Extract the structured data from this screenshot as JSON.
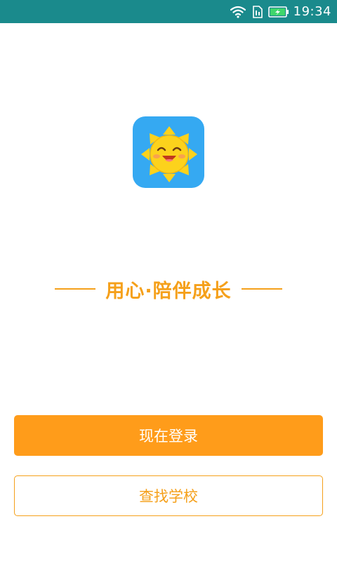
{
  "status_bar": {
    "time": "19:34",
    "icons": [
      "wifi-icon",
      "sim-icon",
      "battery-charging-icon"
    ],
    "background": "#1a8a8c"
  },
  "logo": {
    "icon": "sun-logo-icon",
    "background": "#35a9f2"
  },
  "slogan": {
    "text": "用心·陪伴成长",
    "color": "#f5a01a"
  },
  "buttons": {
    "login_label": "现在登录",
    "find_school_label": "查找学校"
  },
  "colors": {
    "accent": "#ff9c1a",
    "accent_text": "#f5a01a"
  }
}
